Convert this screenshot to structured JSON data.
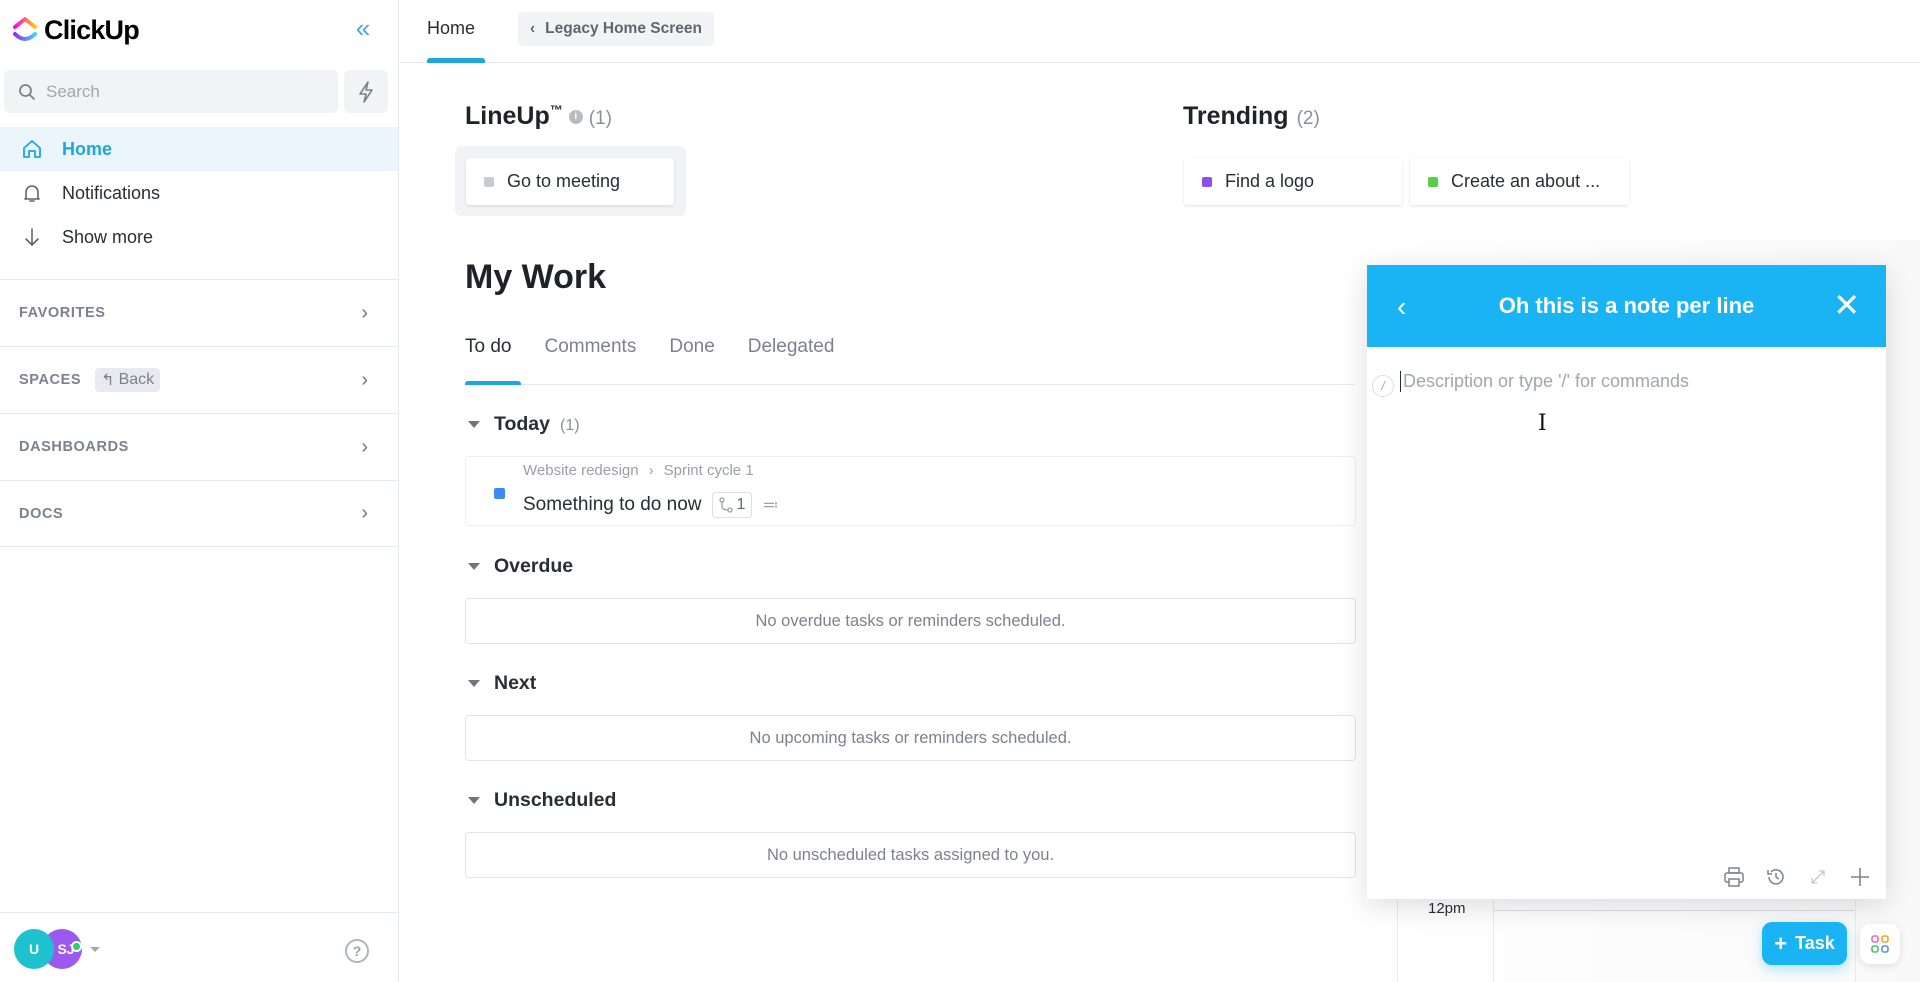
{
  "app": {
    "name": "ClickUp"
  },
  "sidebar": {
    "search_placeholder": "Search",
    "nav": [
      {
        "label": "Home",
        "icon": "home-icon",
        "active": true
      },
      {
        "label": "Notifications",
        "icon": "bell-icon"
      },
      {
        "label": "Show more",
        "icon": "arrow-down-icon"
      }
    ],
    "sections": [
      {
        "label": "FAVORITES"
      },
      {
        "label": "SPACES",
        "back_label": "Back"
      },
      {
        "label": "DASHBOARDS"
      },
      {
        "label": "DOCS"
      }
    ],
    "user": {
      "avatars": [
        "U",
        "SJ"
      ],
      "online": true,
      "help_label": "?"
    }
  },
  "header": {
    "tab": "Home",
    "legacy_button": "Legacy Home Screen"
  },
  "lineup": {
    "title": "LineUp",
    "tm": "™",
    "count": "(1)",
    "items": [
      {
        "label": "Go to meeting",
        "color": "#c8cbd0"
      }
    ]
  },
  "trending": {
    "title": "Trending",
    "count": "(2)",
    "items": [
      {
        "label": "Find a logo",
        "color": "#8b4ef0"
      },
      {
        "label": "Create an about ...",
        "color": "#55cf45"
      }
    ]
  },
  "my_work": {
    "title": "My Work",
    "tabs": [
      "To do",
      "Comments",
      "Done",
      "Delegated"
    ],
    "active_tab": "To do",
    "groups": [
      {
        "label": "Today",
        "count": "(1)"
      },
      {
        "label": "Overdue",
        "empty": "No overdue tasks or reminders scheduled."
      },
      {
        "label": "Next",
        "empty": "No upcoming tasks or reminders scheduled."
      },
      {
        "label": "Unscheduled",
        "empty": "No unscheduled tasks assigned to you."
      }
    ],
    "today_task": {
      "list": "Website redesign",
      "sprint": "Sprint cycle 1",
      "name": "Something to do now",
      "subtasks": "1",
      "status_color": "#3d8af7"
    }
  },
  "calendar": {
    "time_label": "12pm"
  },
  "note_modal": {
    "title": "Oh this is a note per line",
    "placeholder": "Description or type '/' for commands",
    "slash_label": "/",
    "tools": [
      "print-icon",
      "history-icon",
      "expand-icon",
      "plus-icon"
    ]
  },
  "fab": {
    "task_label": "Task"
  },
  "colors": {
    "accent": "#1ab4f5",
    "brand_blue": "#1ea6dd"
  }
}
